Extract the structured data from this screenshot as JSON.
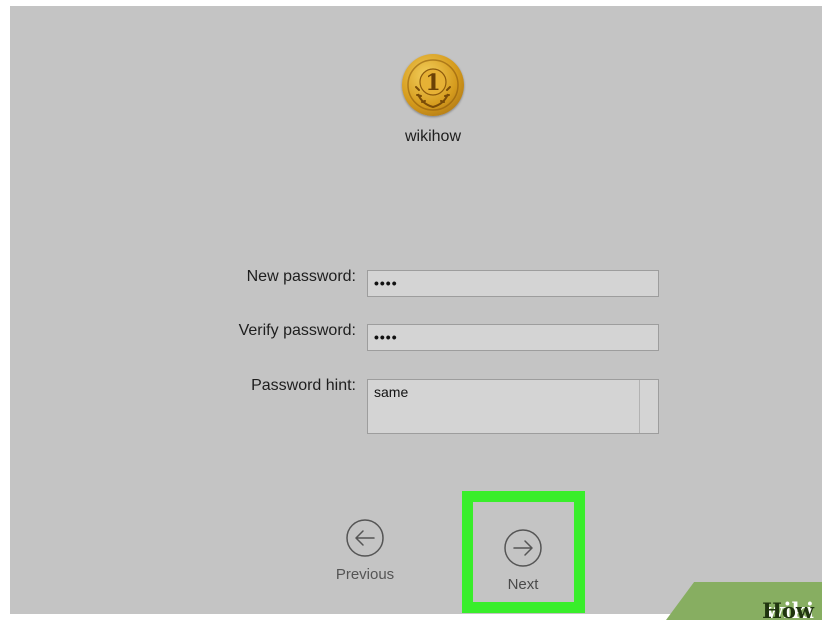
{
  "user": {
    "name": "wikihow",
    "avatar_icon": "gold-medal-icon"
  },
  "form": {
    "new_password_label": "New password:",
    "new_password_value": "••••",
    "verify_password_label": "Verify password:",
    "verify_password_value": "••••",
    "hint_label": "Password hint:",
    "hint_value": "same"
  },
  "nav": {
    "previous_label": "Previous",
    "previous_icon": "arrow-left-circle-icon",
    "next_label": "Next",
    "next_icon": "arrow-right-circle-icon",
    "highlight_color": "#39ee2b"
  },
  "watermark": {
    "part1": "wiki",
    "part2": "How"
  }
}
